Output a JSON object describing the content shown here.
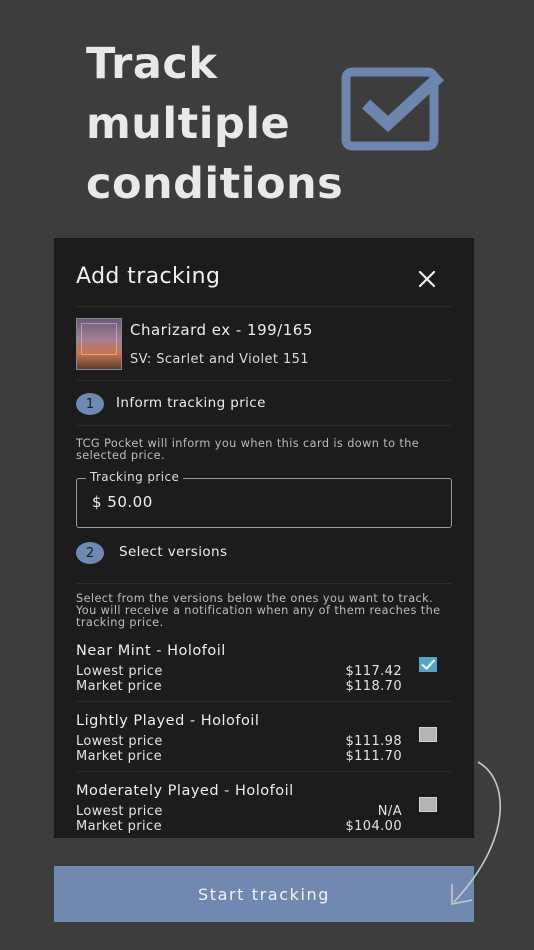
{
  "hero": {
    "title_lines": [
      "Track",
      "multiple",
      "conditions"
    ],
    "icon": "checkbox-check-icon"
  },
  "colors": {
    "background": "#3d3d3e",
    "modal": "#1c1c1c",
    "accent": "#7189b1",
    "checkbox_on": "#57a3c2"
  },
  "modal": {
    "title": "Add tracking",
    "close_icon": "close-icon"
  },
  "card": {
    "name": "Charizard ex - 199/165",
    "set": "SV: Scarlet and Violet 151"
  },
  "step1": {
    "number": "1",
    "label": "Inform tracking price",
    "help": "TCG Pocket will inform you when this card is down to the selected price."
  },
  "price_field": {
    "label": "Tracking price",
    "value": "$ 50.00"
  },
  "step2": {
    "number": "2",
    "label": "Select versions",
    "help": "Select from the versions below the ones you want to track. You will receive a notification when any of them reaches the tracking price."
  },
  "versions": [
    {
      "name": "Near Mint - Holofoil",
      "lowest_label": "Lowest price",
      "lowest": "$117.42",
      "market_label": "Market price",
      "market": "$118.70",
      "checked": true
    },
    {
      "name": "Lightly Played - Holofoil",
      "lowest_label": "Lowest price",
      "lowest": "$111.98",
      "market_label": "Market price",
      "market": "$111.70",
      "checked": false
    },
    {
      "name": "Moderately Played - Holofoil",
      "lowest_label": "Lowest price",
      "lowest": "N/A",
      "market_label": "Market price",
      "market": "$104.00",
      "checked": false
    }
  ],
  "start_button": {
    "label": "Start tracking"
  }
}
